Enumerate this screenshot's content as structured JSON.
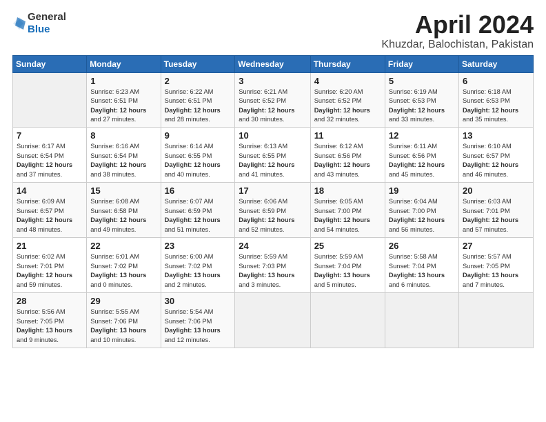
{
  "header": {
    "logo_general": "General",
    "logo_blue": "Blue",
    "title": "April 2024",
    "subtitle": "Khuzdar, Balochistan, Pakistan"
  },
  "calendar": {
    "days_of_week": [
      "Sunday",
      "Monday",
      "Tuesday",
      "Wednesday",
      "Thursday",
      "Friday",
      "Saturday"
    ],
    "weeks": [
      [
        {
          "day": "",
          "info": ""
        },
        {
          "day": "1",
          "info": "Sunrise: 6:23 AM\nSunset: 6:51 PM\nDaylight: 12 hours\nand 27 minutes."
        },
        {
          "day": "2",
          "info": "Sunrise: 6:22 AM\nSunset: 6:51 PM\nDaylight: 12 hours\nand 28 minutes."
        },
        {
          "day": "3",
          "info": "Sunrise: 6:21 AM\nSunset: 6:52 PM\nDaylight: 12 hours\nand 30 minutes."
        },
        {
          "day": "4",
          "info": "Sunrise: 6:20 AM\nSunset: 6:52 PM\nDaylight: 12 hours\nand 32 minutes."
        },
        {
          "day": "5",
          "info": "Sunrise: 6:19 AM\nSunset: 6:53 PM\nDaylight: 12 hours\nand 33 minutes."
        },
        {
          "day": "6",
          "info": "Sunrise: 6:18 AM\nSunset: 6:53 PM\nDaylight: 12 hours\nand 35 minutes."
        }
      ],
      [
        {
          "day": "7",
          "info": "Sunrise: 6:17 AM\nSunset: 6:54 PM\nDaylight: 12 hours\nand 37 minutes."
        },
        {
          "day": "8",
          "info": "Sunrise: 6:16 AM\nSunset: 6:54 PM\nDaylight: 12 hours\nand 38 minutes."
        },
        {
          "day": "9",
          "info": "Sunrise: 6:14 AM\nSunset: 6:55 PM\nDaylight: 12 hours\nand 40 minutes."
        },
        {
          "day": "10",
          "info": "Sunrise: 6:13 AM\nSunset: 6:55 PM\nDaylight: 12 hours\nand 41 minutes."
        },
        {
          "day": "11",
          "info": "Sunrise: 6:12 AM\nSunset: 6:56 PM\nDaylight: 12 hours\nand 43 minutes."
        },
        {
          "day": "12",
          "info": "Sunrise: 6:11 AM\nSunset: 6:56 PM\nDaylight: 12 hours\nand 45 minutes."
        },
        {
          "day": "13",
          "info": "Sunrise: 6:10 AM\nSunset: 6:57 PM\nDaylight: 12 hours\nand 46 minutes."
        }
      ],
      [
        {
          "day": "14",
          "info": "Sunrise: 6:09 AM\nSunset: 6:57 PM\nDaylight: 12 hours\nand 48 minutes."
        },
        {
          "day": "15",
          "info": "Sunrise: 6:08 AM\nSunset: 6:58 PM\nDaylight: 12 hours\nand 49 minutes."
        },
        {
          "day": "16",
          "info": "Sunrise: 6:07 AM\nSunset: 6:59 PM\nDaylight: 12 hours\nand 51 minutes."
        },
        {
          "day": "17",
          "info": "Sunrise: 6:06 AM\nSunset: 6:59 PM\nDaylight: 12 hours\nand 52 minutes."
        },
        {
          "day": "18",
          "info": "Sunrise: 6:05 AM\nSunset: 7:00 PM\nDaylight: 12 hours\nand 54 minutes."
        },
        {
          "day": "19",
          "info": "Sunrise: 6:04 AM\nSunset: 7:00 PM\nDaylight: 12 hours\nand 56 minutes."
        },
        {
          "day": "20",
          "info": "Sunrise: 6:03 AM\nSunset: 7:01 PM\nDaylight: 12 hours\nand 57 minutes."
        }
      ],
      [
        {
          "day": "21",
          "info": "Sunrise: 6:02 AM\nSunset: 7:01 PM\nDaylight: 12 hours\nand 59 minutes."
        },
        {
          "day": "22",
          "info": "Sunrise: 6:01 AM\nSunset: 7:02 PM\nDaylight: 13 hours\nand 0 minutes."
        },
        {
          "day": "23",
          "info": "Sunrise: 6:00 AM\nSunset: 7:02 PM\nDaylight: 13 hours\nand 2 minutes."
        },
        {
          "day": "24",
          "info": "Sunrise: 5:59 AM\nSunset: 7:03 PM\nDaylight: 13 hours\nand 3 minutes."
        },
        {
          "day": "25",
          "info": "Sunrise: 5:59 AM\nSunset: 7:04 PM\nDaylight: 13 hours\nand 5 minutes."
        },
        {
          "day": "26",
          "info": "Sunrise: 5:58 AM\nSunset: 7:04 PM\nDaylight: 13 hours\nand 6 minutes."
        },
        {
          "day": "27",
          "info": "Sunrise: 5:57 AM\nSunset: 7:05 PM\nDaylight: 13 hours\nand 7 minutes."
        }
      ],
      [
        {
          "day": "28",
          "info": "Sunrise: 5:56 AM\nSunset: 7:05 PM\nDaylight: 13 hours\nand 9 minutes."
        },
        {
          "day": "29",
          "info": "Sunrise: 5:55 AM\nSunset: 7:06 PM\nDaylight: 13 hours\nand 10 minutes."
        },
        {
          "day": "30",
          "info": "Sunrise: 5:54 AM\nSunset: 7:06 PM\nDaylight: 13 hours\nand 12 minutes."
        },
        {
          "day": "",
          "info": ""
        },
        {
          "day": "",
          "info": ""
        },
        {
          "day": "",
          "info": ""
        },
        {
          "day": "",
          "info": ""
        }
      ]
    ]
  }
}
